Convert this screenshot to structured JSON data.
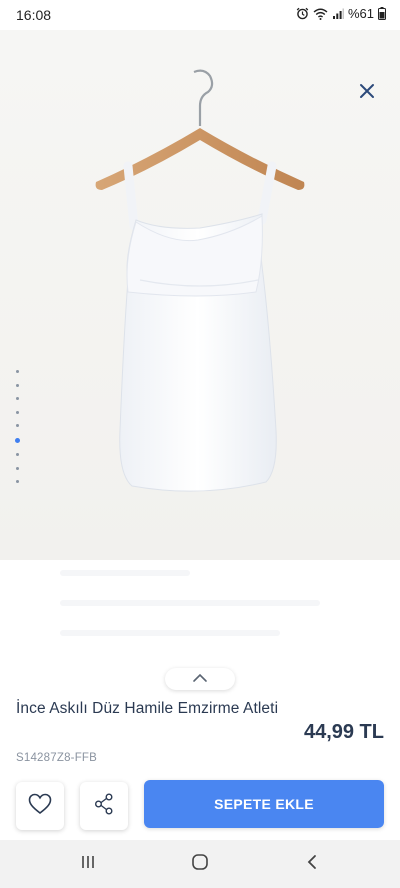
{
  "status_bar": {
    "time": "16:08",
    "battery": "%61",
    "icons": [
      "alarm-icon",
      "wifi-icon",
      "signal-icon",
      "battery-icon"
    ]
  },
  "gallery": {
    "dot_count": 9,
    "active_index": 5
  },
  "product": {
    "name": "İnce Askılı Düz Hamile Emzirme Atleti",
    "price": "44,99 TL",
    "sku": "S14287Z8-FFB"
  },
  "actions": {
    "favorite_icon": "heart-icon",
    "share_icon": "share-icon",
    "add_to_cart_label": "SEPETE EKLE"
  },
  "colors": {
    "accent": "#4a86f1",
    "text": "#2b3a52",
    "active_dot": "#3f7ff0"
  },
  "nav": {
    "icons": [
      "recent-apps-icon",
      "home-icon",
      "back-icon"
    ]
  }
}
